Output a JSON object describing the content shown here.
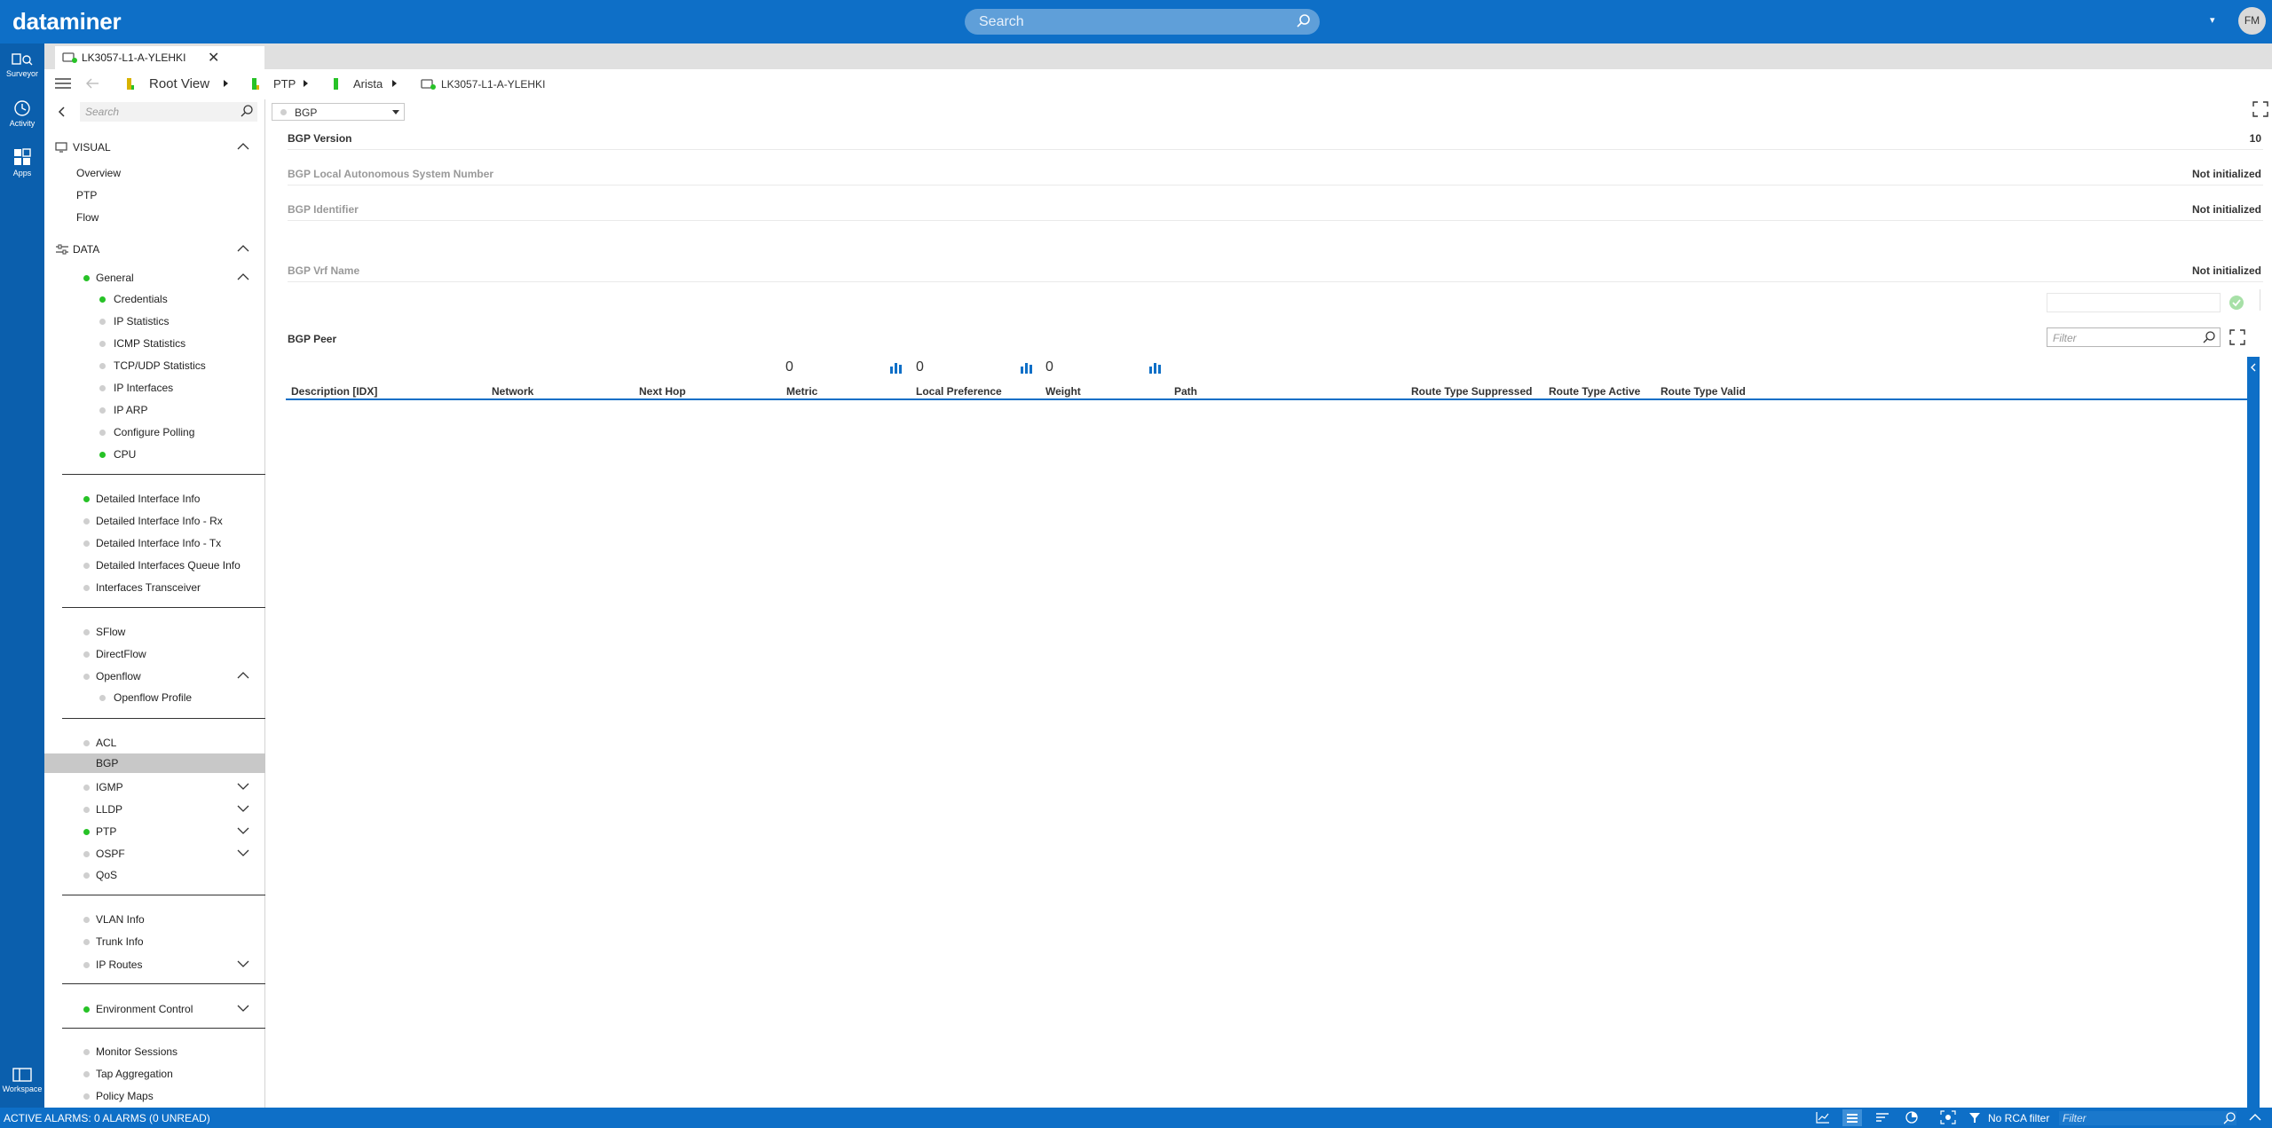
{
  "app": {
    "logo": "dataminer",
    "user_initials": "FM"
  },
  "topbar": {
    "search_placeholder": "Search"
  },
  "rail": [
    {
      "label": "Surveyor",
      "icon": "surveyor-icon"
    },
    {
      "label": "Activity",
      "icon": "history-icon"
    },
    {
      "label": "Apps",
      "icon": "apps-grid-icon"
    },
    {
      "label": "Workspace",
      "icon": "workspace-icon"
    }
  ],
  "tab": {
    "title": "LK3057-L1-A-YLEHKI"
  },
  "breadcrumb": [
    "Root View",
    "PTP",
    "Arista",
    "LK3057-L1-A-YLEHKI"
  ],
  "sidebar": {
    "search_placeholder": "Search",
    "visual": {
      "title": "VISUAL",
      "items": [
        "Overview",
        "PTP",
        "Flow"
      ]
    },
    "data": {
      "title": "DATA"
    },
    "general": {
      "label": "General",
      "children": [
        "Credentials",
        "IP Statistics",
        "ICMP Statistics",
        "TCP/UDP Statistics",
        "IP Interfaces",
        "IP ARP",
        "Configure Polling",
        "CPU"
      ]
    },
    "group2": [
      "Detailed Interface Info",
      "Detailed Interface Info - Rx",
      "Detailed Interface Info - Tx",
      "Detailed Interfaces Queue Info",
      "Interfaces Transceiver"
    ],
    "group3": [
      "SFlow",
      "DirectFlow",
      "Openflow",
      "Openflow Profile"
    ],
    "group4": [
      "ACL",
      "BGP",
      "IGMP",
      "LLDP",
      "PTP",
      "OSPF",
      "QoS"
    ],
    "group5": [
      "VLAN Info",
      "Trunk Info",
      "IP Routes"
    ],
    "group6": [
      "Environment Control"
    ],
    "group7": [
      "Monitor Sessions",
      "Tap Aggregation",
      "Policy Maps"
    ]
  },
  "page": {
    "selected": "BGP",
    "params": [
      {
        "label": "BGP Version",
        "value": "10"
      },
      {
        "label": "BGP Local Autonomous System Number",
        "value": "Not initialized"
      },
      {
        "label": "BGP Identifier",
        "value": "Not initialized"
      },
      {
        "label": "BGP Vrf Name",
        "value": "Not initialized"
      }
    ],
    "table": {
      "title": "BGP Peer",
      "filter_placeholder": "Filter",
      "columns": [
        "Description [IDX]",
        "Network",
        "Next Hop",
        "Metric",
        "Local Preference",
        "Weight",
        "Path",
        "Route Type Suppressed",
        "Route Type Active",
        "Route Type Valid"
      ],
      "metric_total": "0",
      "local_pref_total": "0",
      "weight_total": "0"
    }
  },
  "statusbar": {
    "alarms": "ACTIVE ALARMS: 0 ALARMS (0 UNREAD)",
    "rca": "No RCA filter",
    "filter_placeholder": "Filter"
  },
  "colors": {
    "brand": "#0e6fc7",
    "ok": "#27c227"
  }
}
